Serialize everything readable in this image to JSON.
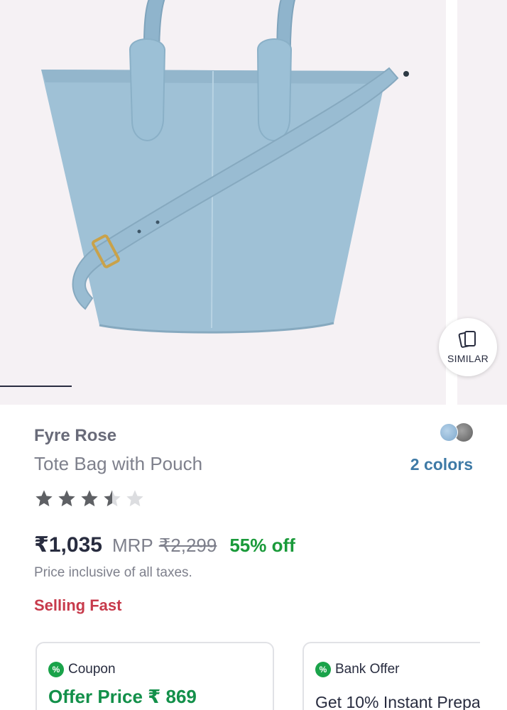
{
  "hero": {
    "similar_label": "SIMILAR",
    "similar_icon": "stacked-cards-icon"
  },
  "product": {
    "brand": "Fyre Rose",
    "name": "Tote Bag with Pouch",
    "colors_link": "2 colors",
    "rating_out_of_5": 3.5,
    "price": "₹1,035",
    "mrp_label": "MRP",
    "mrp_value": "₹2,299",
    "discount": "55% off",
    "tax_note": "Price inclusive of all taxes.",
    "urgency": "Selling Fast"
  },
  "offers": [
    {
      "tag": "Coupon",
      "icon": "percent-badge-icon",
      "title": "Offer Price ₹ 869"
    },
    {
      "tag": "Bank Offer",
      "icon": "percent-badge-icon",
      "title": "Get 10% Instant Prepa"
    }
  ],
  "colors": {
    "bag": "#9fc1d6",
    "accent_green": "#1a9a3a",
    "urgency_red": "#c73a4b",
    "link_blue": "#3e7aa6"
  }
}
